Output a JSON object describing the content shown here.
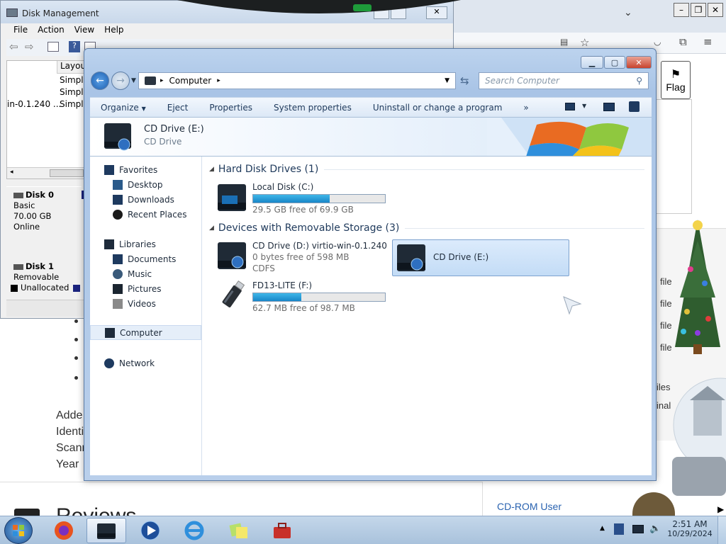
{
  "browser": {
    "flag_label": "Flag",
    "file_links": [
      "file",
      "file",
      "file",
      "file"
    ],
    "side_text": [
      "iles",
      "inal"
    ],
    "body_lines": [
      "Adde",
      "Identi",
      "Scann",
      "Year"
    ],
    "heading_partial": "Reviews",
    "cdrom_user": "CD-ROM User"
  },
  "disk_management": {
    "title": "Disk Management",
    "menu": [
      "File",
      "Action",
      "View",
      "Help"
    ],
    "column_header": "Layout",
    "rows": [
      {
        "name": "",
        "layout": "Simple"
      },
      {
        "name": "",
        "layout": "Simple"
      },
      {
        "name": "in-0.1.240 ...",
        "layout": "Simple"
      }
    ],
    "disks": [
      {
        "name": "Disk 0",
        "lines": [
          "Basic",
          "70.00 GB",
          "Online"
        ]
      },
      {
        "name": "Disk 1",
        "lines": [
          "Removable"
        ]
      }
    ],
    "legend_unallocated": "Unallocated"
  },
  "explorer": {
    "breadcrumb": "Computer",
    "search_placeholder": "Search Computer",
    "toolbar": [
      "Organize",
      "Eject",
      "Properties",
      "System properties",
      "Uninstall or change a program"
    ],
    "overflow": "»",
    "details": {
      "title": "CD Drive (E:)",
      "subtitle": "CD Drive"
    },
    "nav": {
      "favorites": "Favorites",
      "favorites_items": [
        "Desktop",
        "Downloads",
        "Recent Places"
      ],
      "libraries": "Libraries",
      "libraries_items": [
        "Documents",
        "Music",
        "Pictures",
        "Videos"
      ],
      "computer": "Computer",
      "network": "Network"
    },
    "groups": [
      {
        "title": "Hard Disk Drives (1)",
        "drives": [
          {
            "name": "Local Disk (C:)",
            "info": "29.5 GB free of 69.9 GB",
            "used_fraction": 0.58
          }
        ]
      },
      {
        "title": "Devices with Removable Storage (3)",
        "drives": [
          {
            "name": "CD Drive (D:) virtio-win-0.1.240",
            "info": "0 bytes free of 598 MB",
            "fs": "CDFS"
          },
          {
            "name": "CD Drive (E:)"
          },
          {
            "name": "FD13-LITE (F:)",
            "info": "62.7 MB free of 98.7 MB",
            "used_fraction": 0.365
          }
        ]
      }
    ]
  },
  "taskbar": {
    "time": "2:51 AM",
    "date": "10/29/2024"
  }
}
